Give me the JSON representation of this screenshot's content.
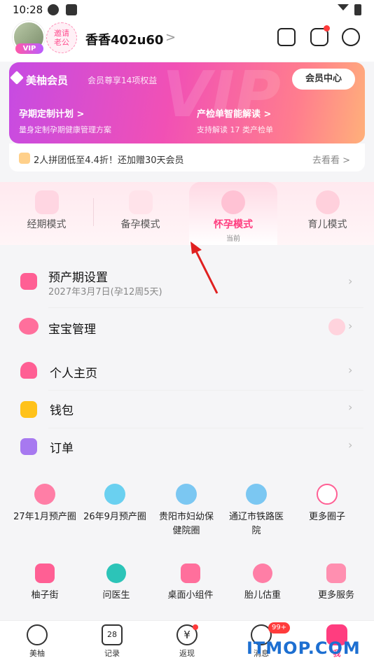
{
  "status_bar": {
    "time": "10:28"
  },
  "header": {
    "vip_tag": "VIP",
    "invite_label": "邀请\n老公",
    "invite_line1": "邀请",
    "invite_line2": "老公",
    "username": "香香402u60",
    "chevron": ">"
  },
  "vip_card": {
    "watermark": "VIP",
    "title": "美柚会员",
    "subtitle": "会员尊享14项权益",
    "center_button": "会员中心",
    "features": [
      {
        "title": "孕期定制计划 >",
        "desc": "量身定制孕期健康管理方案"
      },
      {
        "title": "产检单智能解读 >",
        "desc": "支持解读 17 类产检单"
      }
    ]
  },
  "promo": {
    "text": "2人拼团低至4.4折！还加赠30天会员",
    "action": "去看看 >"
  },
  "modes": [
    {
      "label": "经期模式"
    },
    {
      "label": "备孕模式"
    },
    {
      "label": "怀孕模式",
      "sub": "当前"
    },
    {
      "label": "育儿模式"
    }
  ],
  "pregnancy_card": {
    "due": {
      "title": "预产期设置",
      "sub": "2027年3月7日(孕12周5天)"
    },
    "baby": {
      "title": "宝宝管理"
    }
  },
  "menu_card": [
    {
      "title": "个人主页"
    },
    {
      "title": "钱包"
    },
    {
      "title": "订单"
    }
  ],
  "circles": [
    {
      "label": "27年1月预产圈"
    },
    {
      "label": "26年9月预产圈"
    },
    {
      "label": "贵阳市妇幼保健院圈"
    },
    {
      "label": "通辽市铁路医院"
    },
    {
      "label": "更多圈子"
    }
  ],
  "services": [
    {
      "label": "柚子街"
    },
    {
      "label": "问医生"
    },
    {
      "label": "桌面小组件"
    },
    {
      "label": "胎儿估重"
    },
    {
      "label": "更多服务"
    }
  ],
  "tabbar": [
    {
      "label": "美柚"
    },
    {
      "label": "记录",
      "icon_text": "28"
    },
    {
      "label": "返现",
      "icon_text": "¥"
    },
    {
      "label": "消息",
      "badge": "99+"
    },
    {
      "label": "我"
    }
  ],
  "overlay": {
    "watermark": "ITMOP.COM"
  },
  "colors": {
    "accent": "#ff3d7f",
    "vip_start": "#c64be3",
    "vip_end": "#ffb07a"
  }
}
